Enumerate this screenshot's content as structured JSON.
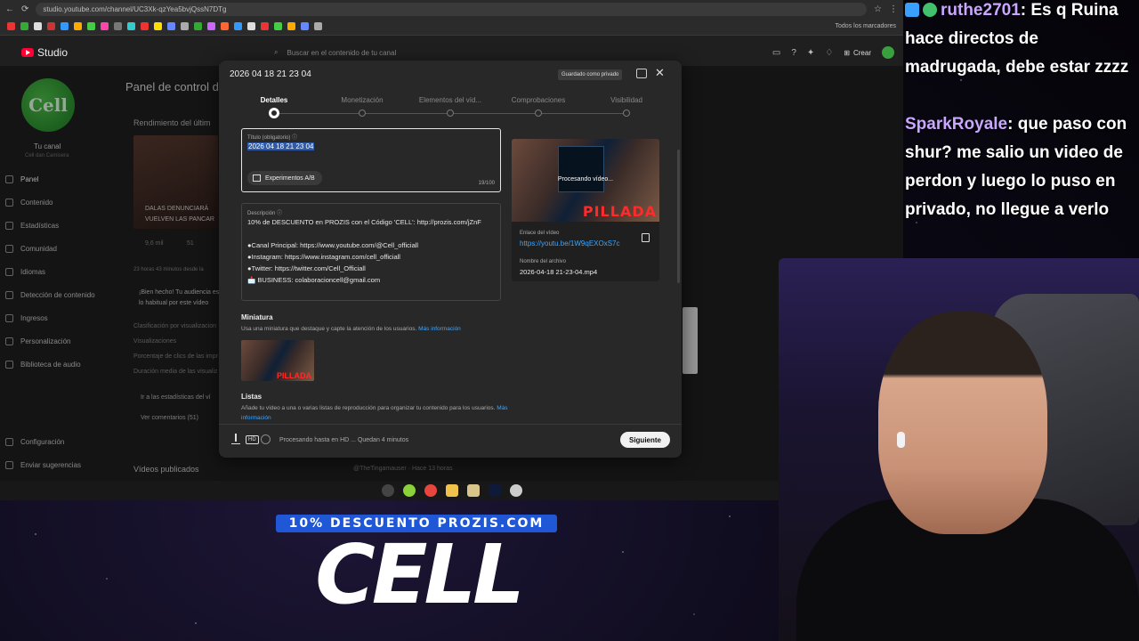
{
  "browser": {
    "url": "studio.youtube.com/channel/UC3Xk-qzYea5bvjQssN7DTg",
    "bookmarks_label": "Todos los marcadores"
  },
  "studio": {
    "logo": "Studio",
    "search_placeholder": "Buscar en el contenido de tu canal",
    "create_label": "Crear",
    "channel_name": "Tu canal",
    "channel_handle": "Cell dan Camisera",
    "avatar_text": "Cell",
    "nav": [
      "Panel",
      "Contenido",
      "Estadísticas",
      "Comunidad",
      "Idiomas",
      "Detección de contenido",
      "Ingresos",
      "Personalización",
      "Biblioteca de audio"
    ],
    "nav_bottom": [
      "Configuración",
      "Enviar sugerencias"
    ],
    "page_title": "Panel de control d",
    "performance_title": "Rendimiento del últim",
    "card_text_1": "DALAS DENUNCIARÁ",
    "card_text_2": "VUELVEN LAS PANCAR",
    "stats_views": "9,6 mil",
    "stats_comments": "51",
    "time_ago": "23 horas 43 minutos desde la",
    "audience_text_1": "¡Bien hecho! Tu audiencia es",
    "audience_text_2": "lo habitual por este vídeo",
    "metric_1": "Clasificación por visualizacion",
    "metric_2": "Visualizaciones",
    "metric_3": "Porcentaje de clics de las impr",
    "metric_4": "Duración media de las visualiz",
    "stats_link": "Ir a las estadísticas del ví",
    "comments_link": "Ver comentarios (51)",
    "published_videos": "Vídeos publicados",
    "comment_author": "@TheTingamauser · Hace 13 horas"
  },
  "modal": {
    "title": "2026 04 18 21 23 04",
    "saved_badge": "Guardado como privado",
    "steps": [
      "Detalles",
      "Monetización",
      "Elementos del víd...",
      "Comprobaciones",
      "Visibilidad"
    ],
    "title_label": "Título (obligatorio)",
    "title_value": "2026 04 18 21 23 04",
    "ab_label": "Experimentos A/B",
    "char_count": "19/100",
    "desc_label": "Descripción",
    "desc_lines": [
      "10% de DESCUENTO en PROZIS con el Código 'CELL': http://prozis.com/jZnF",
      "",
      "●Canal Principal: https://www.youtube.com/@Cell_officiall",
      "●Instagram: https://www.instagram.com/cell_officiall",
      "●Twitter: https://twitter.com/Cell_Officiall",
      "📩 BUSINESS: colaboracioncell@gmail.com"
    ],
    "preview_status": "Procesando vídeo...",
    "preview_text": "PILLADA",
    "link_label": "Enlace del vídeo",
    "link_value": "https://youtu.be/1W9qEXOxS7c",
    "file_label": "Nombre del archivo",
    "file_value": "2026-04-18 21-23-04.mp4",
    "thumb_title": "Miniatura",
    "thumb_desc": "Usa una miniatura que destaque y capte la atención de los usuarios.",
    "thumb_link": "Más información",
    "lists_title": "Listas",
    "lists_desc": "Añade tu vídeo a una o varias listas de reproducción para organizar tu contenido para los usuarios.",
    "lists_link": "Más información",
    "status_text": "Procesando hasta en HD ... Quedan 4 minutos",
    "hd_label": "HD",
    "next_label": "Siguiente"
  },
  "chat": [
    {
      "user": "ruthe2701",
      "text": ": Es q Ruina hace directos de madrugada, debe estar zzzz"
    },
    {
      "user": "SparkRoyale",
      "text": ": que paso con shur? me salio un video de perdon y luego lo puso en privado, no llegue a verlo"
    }
  ],
  "overlay": {
    "promo": "10% DESCUENTO PROZIS.COM",
    "logo": "CELL"
  }
}
